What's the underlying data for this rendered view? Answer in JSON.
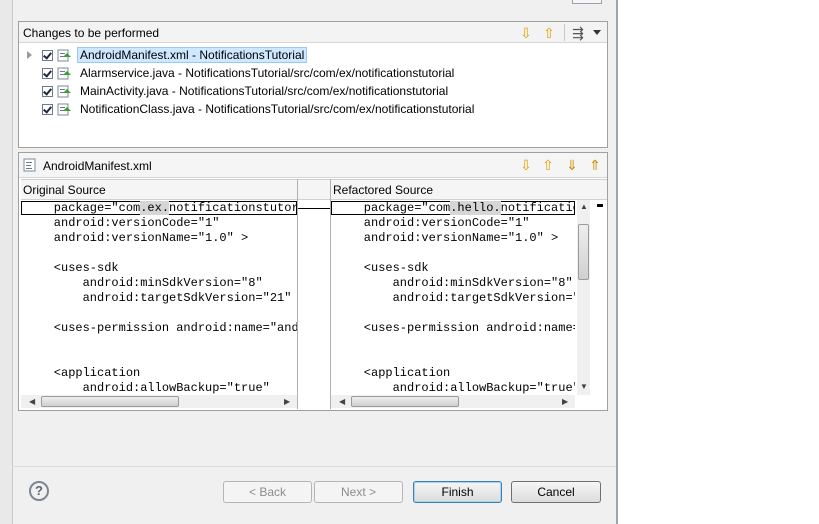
{
  "changes_panel": {
    "title": "Changes to be performed",
    "items": [
      {
        "label": "AndroidManifest.xml - NotificationsTutorial",
        "checked": true,
        "selected": true,
        "icon": "xml-file-icon"
      },
      {
        "label": "Alarmservice.java - NotificationsTutorial/src/com/ex/notificationstutorial",
        "checked": true,
        "icon": "java-file-icon"
      },
      {
        "label": "MainActivity.java - NotificationsTutorial/src/com/ex/notificationstutorial",
        "checked": true,
        "icon": "java-file-icon"
      },
      {
        "label": "NotificationClass.java - NotificationsTutorial/src/com/ex/notificationstutorial",
        "checked": true,
        "icon": "java-file-icon"
      }
    ]
  },
  "compare_panel": {
    "file_title": "AndroidManifest.xml",
    "original_header": "Original Source",
    "refactored_header": "Refactored Source",
    "original_lines": [
      "    package=\"com.ex.notificationstutor",
      "    android:versionCode=\"1\"",
      "    android:versionName=\"1.0\" >",
      "",
      "    <uses-sdk",
      "        android:minSdkVersion=\"8\"",
      "        android:targetSdkVersion=\"21\" /",
      "",
      "    <uses-permission android:name=\"andr",
      "",
      "",
      "    <application",
      "        android:allowBackup=\"true\""
    ],
    "refactored_lines": [
      "    package=\"com.hello.notificatio",
      "    android:versionCode=\"1\"",
      "    android:versionName=\"1.0\" >",
      "",
      "    <uses-sdk",
      "        android:minSdkVersion=\"8\"",
      "        android:targetSdkVersion=\"",
      "",
      "    <uses-permission android:name=",
      "",
      "",
      "    <application",
      "        android:allowBackup=\"true\""
    ]
  },
  "buttons": {
    "help": "?",
    "back": "< Back",
    "next": "Next >",
    "finish": "Finish",
    "cancel": "Cancel"
  },
  "colors": {
    "selection": "#cde8ff",
    "change_highlight": "#d6d6d6",
    "accent": "#3c7fb1"
  }
}
